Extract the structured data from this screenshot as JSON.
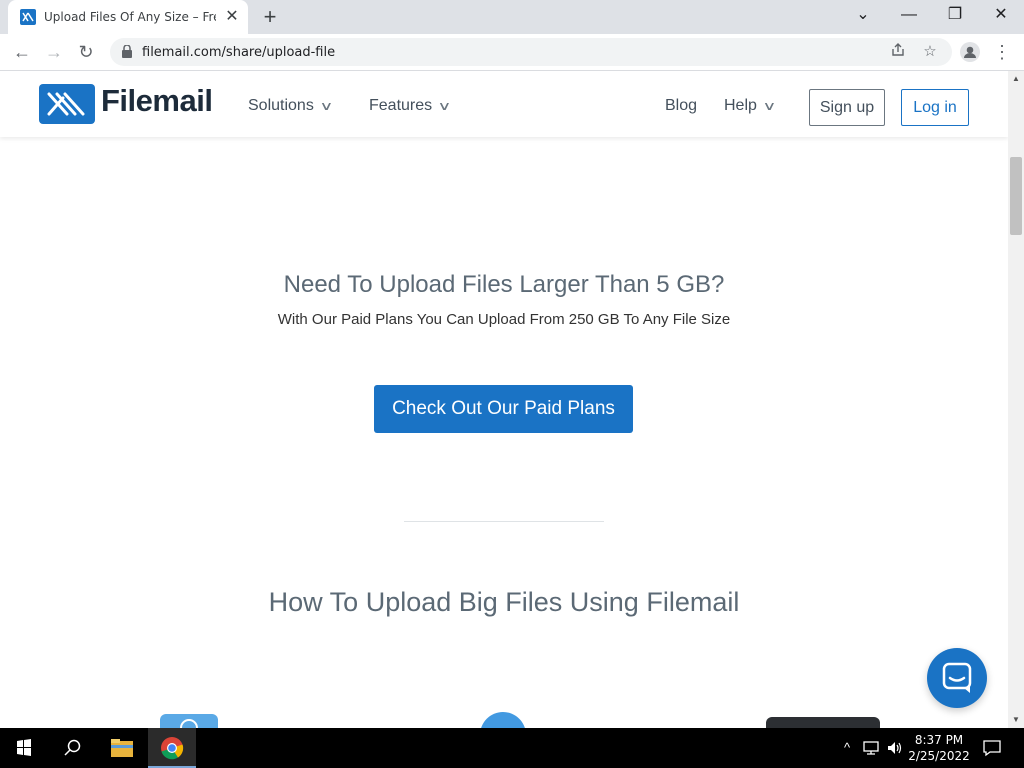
{
  "browser": {
    "tab_title": "Upload Files Of Any Size – Free Up",
    "tab_close": "✕",
    "new_tab": "+",
    "window_controls": {
      "collapse": "⌄",
      "minimize": "—",
      "restore": "❐",
      "close": "✕"
    },
    "nav": {
      "back": "←",
      "forward": "→",
      "reload": "↻"
    },
    "url": "filemail.com/share/upload-file",
    "omnibox_icons": {
      "share": "share-icon",
      "bookmark": "☆"
    },
    "profile_icon": "person-icon",
    "menu": "⋮"
  },
  "site": {
    "logo_text": "Filemail",
    "nav": {
      "solutions": "Solutions",
      "features": "Features",
      "blog": "Blog",
      "help": "Help",
      "chevron": "∨"
    },
    "signup": "Sign up",
    "login": "Log in",
    "brand_color": "#1a73c5"
  },
  "main": {
    "promo_title": "Need To Upload Files Larger Than 5 GB?",
    "promo_subtitle": "With Our Paid Plans You Can Upload From 250 GB To Any File Size",
    "cta": "Check Out Our Paid Plans",
    "how_title": "How To Upload Big Files Using Filemail"
  },
  "chat_widget": {
    "icon": "chat-icon"
  },
  "scrollbar": {
    "up": "▲",
    "down": "▼",
    "position": 0.13
  },
  "taskbar": {
    "apps": [
      "windows-start",
      "search",
      "file-explorer",
      "chrome"
    ],
    "tray": {
      "chevron": "^",
      "network": "network-icon",
      "volume": "volume-icon"
    },
    "time": "8:37 PM",
    "date": "2/25/2022",
    "notifications": "notifications-icon"
  }
}
